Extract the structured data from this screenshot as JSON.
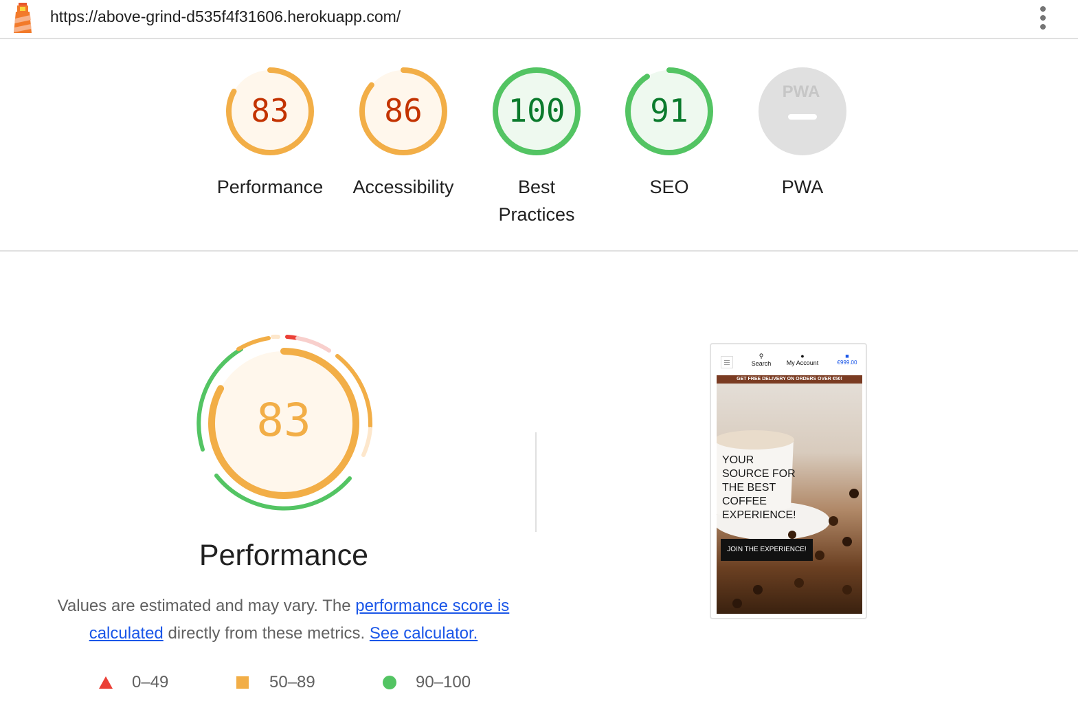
{
  "header": {
    "url": "https://above-grind-d535f4f31606.herokuapp.com/"
  },
  "gauges": [
    {
      "label": "Performance",
      "score": "83",
      "value": 0.83,
      "rating": "average"
    },
    {
      "label": "Accessibility",
      "score": "86",
      "value": 0.86,
      "rating": "average"
    },
    {
      "label": "Best Practices",
      "score": "100",
      "value": 1.0,
      "rating": "pass"
    },
    {
      "label": "SEO",
      "score": "91",
      "value": 0.91,
      "rating": "pass"
    },
    {
      "label": "PWA",
      "score": "",
      "value": null,
      "rating": "na"
    }
  ],
  "pwa_badge": "PWA",
  "performance": {
    "score": "83",
    "title": "Performance",
    "desc_text_1": "Values are estimated and may vary. The ",
    "desc_link_1": "performance score is calculated",
    "desc_text_2": " directly from these metrics. ",
    "desc_link_2": "See calculator."
  },
  "legend": [
    {
      "shape": "triangle",
      "label": "0–49",
      "color": "#eb3f36"
    },
    {
      "shape": "square",
      "label": "50–89",
      "color": "#f2ae47"
    },
    {
      "shape": "circle",
      "label": "90–100",
      "color": "#53c463"
    }
  ],
  "thumbnail": {
    "nav_search": "Search",
    "nav_account": "My Account",
    "nav_cart": "€999.00",
    "banner": "GET FREE DELIVERY ON ORDERS OVER €50!",
    "hero_text": [
      "YOUR",
      "SOURCE FOR",
      "THE BEST",
      "COFFEE",
      "EXPERIENCE!"
    ],
    "button": "JOIN THE EXPERIENCE!"
  },
  "colors": {
    "fail": "#eb3f36",
    "average": "#f2ae47",
    "pass": "#53c463",
    "average_text": "#c33300",
    "pass_text": "#0a7a2c",
    "na": "#e0e0e0",
    "link": "#1a56e8"
  }
}
